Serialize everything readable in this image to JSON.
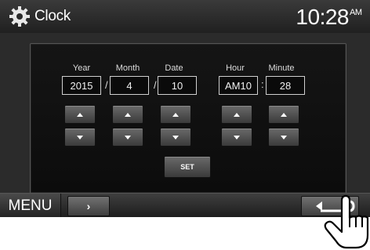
{
  "header": {
    "title": "Clock",
    "time": "10:28",
    "ampm": "AM"
  },
  "fields": [
    {
      "label": "Year",
      "value": "2015"
    },
    {
      "label": "Month",
      "value": "4"
    },
    {
      "label": "Date",
      "value": "10"
    },
    {
      "label": "Hour",
      "value": "AM10"
    },
    {
      "label": "Minute",
      "value": "28"
    }
  ],
  "separators": {
    "date": "/",
    "time": ":"
  },
  "buttons": {
    "set": "SET",
    "menu": "MENU",
    "next": "›"
  },
  "icons": [
    "gear-icon",
    "arrow-up-icon",
    "arrow-down-icon",
    "return-arrow-icon",
    "pointing-hand-icon"
  ],
  "colors": {
    "background": "#2b2b2b",
    "panel": "#111111",
    "text": "#ffffff"
  }
}
